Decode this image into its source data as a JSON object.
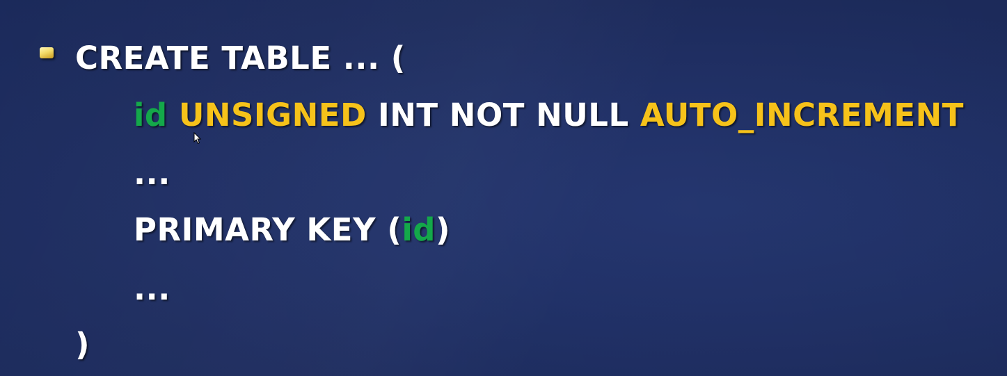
{
  "slide": {
    "bullet_icon": "bullet-square-icon",
    "lines": {
      "l1": "CREATE TABLE ... (",
      "l2": {
        "id": "id",
        "unsigned": "UNSIGNED",
        "int_not_null": "INT NOT NULL",
        "auto_increment": "AUTO_INCREMENT"
      },
      "l3": "...",
      "l4": {
        "primary_key": "PRIMARY KEY",
        "open_paren": "(",
        "id": "id",
        "close_paren": ")"
      },
      "l5": "...",
      "l6": ")"
    },
    "colors": {
      "background": "#1e2d60",
      "text": "#ffffff",
      "identifier": "#14a84a",
      "keyword_highlight": "#f6c21a",
      "bullet": "#f3dc6a"
    }
  }
}
